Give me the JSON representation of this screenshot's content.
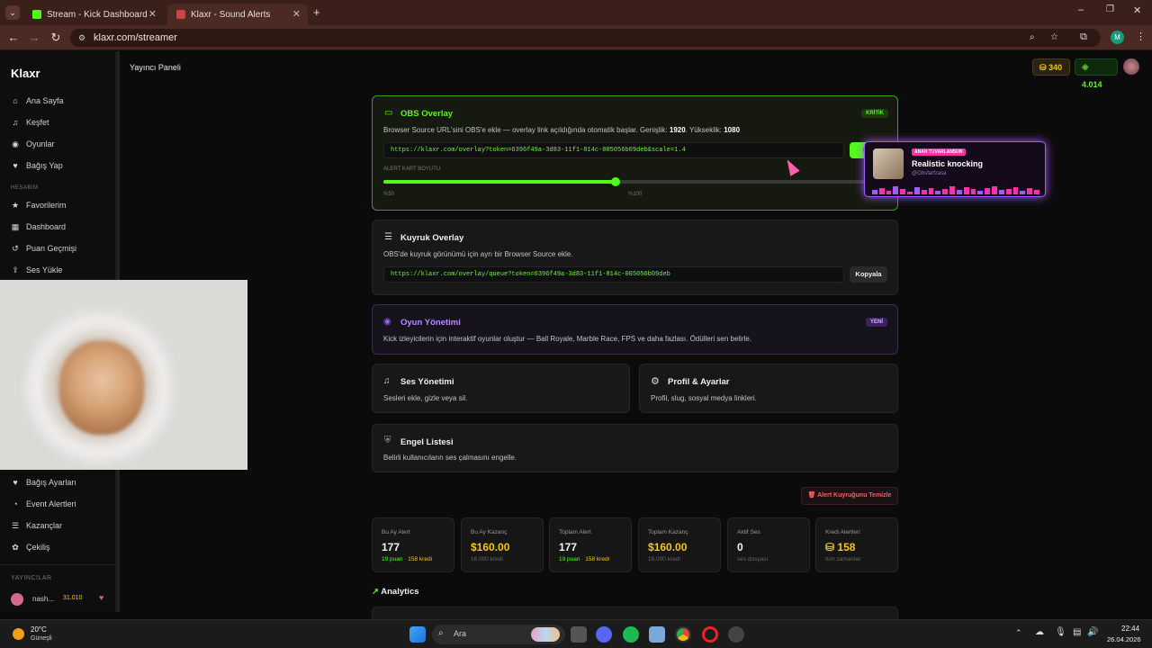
{
  "browser": {
    "tabs": [
      {
        "title": "Stream - Kick Dashboard",
        "active": false
      },
      {
        "title": "Klaxr - Sound Alerts",
        "active": true
      }
    ],
    "url": "klaxr.com/streamer",
    "profile_initial": "M"
  },
  "app": {
    "logo": "Klaxr",
    "page_title": "Yayıncı Paneli",
    "coins": "340",
    "points": "4.014"
  },
  "sidebar": {
    "items": [
      "Ana Sayfa",
      "Keşfet",
      "Oyunlar",
      "Bağış Yap"
    ],
    "account_label": "HESABIM",
    "account_items": [
      "Favorilerim",
      "Dashboard",
      "Puan Geçmişi",
      "Ses Yükle"
    ],
    "lower_items": [
      "Bağış Ayarları",
      "Event Alertleri",
      "Kazançlar",
      "Çekiliş"
    ],
    "streamers_label": "YAYINCILAR",
    "streamer": {
      "name": "nash...",
      "points": "31.010"
    }
  },
  "obs": {
    "title": "OBS Overlay",
    "badge": "KRİTİK",
    "desc_prefix": "Browser Source URL'sini OBS'e ekle — overlay link açıldığında otomatik başlar. Genişlik:",
    "width": "1920",
    "height_label": ". Yükseklik:",
    "height": "1080",
    "url": "https://klaxr.com/overlay?token=6396f49a-3d83-11f1-814c-005056b09deb&scale=1.4",
    "copy": "Ko",
    "size_label": "ALERT KART BOYUTU",
    "slider_fraction": 0.47,
    "min_label": "%50",
    "mid_label": "%100"
  },
  "popup": {
    "tag": "ANAN TUVARLANSUN",
    "title": "Realistic knocking",
    "sub": "@Ghsfarfzasa"
  },
  "queue": {
    "title": "Kuyruk Overlay",
    "desc": "OBS'de kuyruk görünümü için ayrı bir Browser Source ekle.",
    "url": "https://klaxr.com/overlay/queue?token=6396f49a-3d83-11f1-814c-005056b09deb",
    "copy": "Kopyala"
  },
  "games": {
    "title": "Oyun Yönetimi",
    "badge": "YENİ",
    "desc": "Kick izleyicilerin için interaktif oyunlar oluştur — Ball Royale, Marble Race, FPS ve daha fazlası. Ödülleri sen belirle."
  },
  "sound": {
    "title": "Ses Yönetimi",
    "desc": "Sesleri ekle, gizle veya sil."
  },
  "profile": {
    "title": "Profil & Ayarlar",
    "desc": "Profil, slug, sosyal medya linkleri."
  },
  "block": {
    "title": "Engel Listesi",
    "desc": "Belirli kullanıcıların ses çalmasını engelle."
  },
  "clear_btn": "Alert Kuyruğunu Temizle",
  "stats": [
    {
      "label": "Bu Ay Alert",
      "value": "177",
      "sub_a": "19 puan",
      "sub_b": "158 kredi"
    },
    {
      "label": "Bu Ay Kazanç",
      "value": "$160.00",
      "sub": "16.000 kredi"
    },
    {
      "label": "Toplam Alert",
      "value": "177",
      "sub_a": "19 puan",
      "sub_b": "158 kredi"
    },
    {
      "label": "Toplam Kazanç",
      "value": "$160.00",
      "sub": "16.000 kredi"
    },
    {
      "label": "Aktif Ses",
      "value": "0",
      "sub": "ses dosyası"
    },
    {
      "label": "Kredi Alertleri",
      "value": "158",
      "sub": "tüm zamanlar"
    }
  ],
  "analytics": "Analytics",
  "taskbar": {
    "weather_temp": "20°C",
    "weather_desc": "Güneşli",
    "search": "Ara",
    "time": "22:44",
    "date": "26.04.2026"
  },
  "colors": {
    "accent": "#53fc18",
    "gold": "#f5c518",
    "purple": "#a259ff",
    "pink": "#ff2fa8"
  }
}
